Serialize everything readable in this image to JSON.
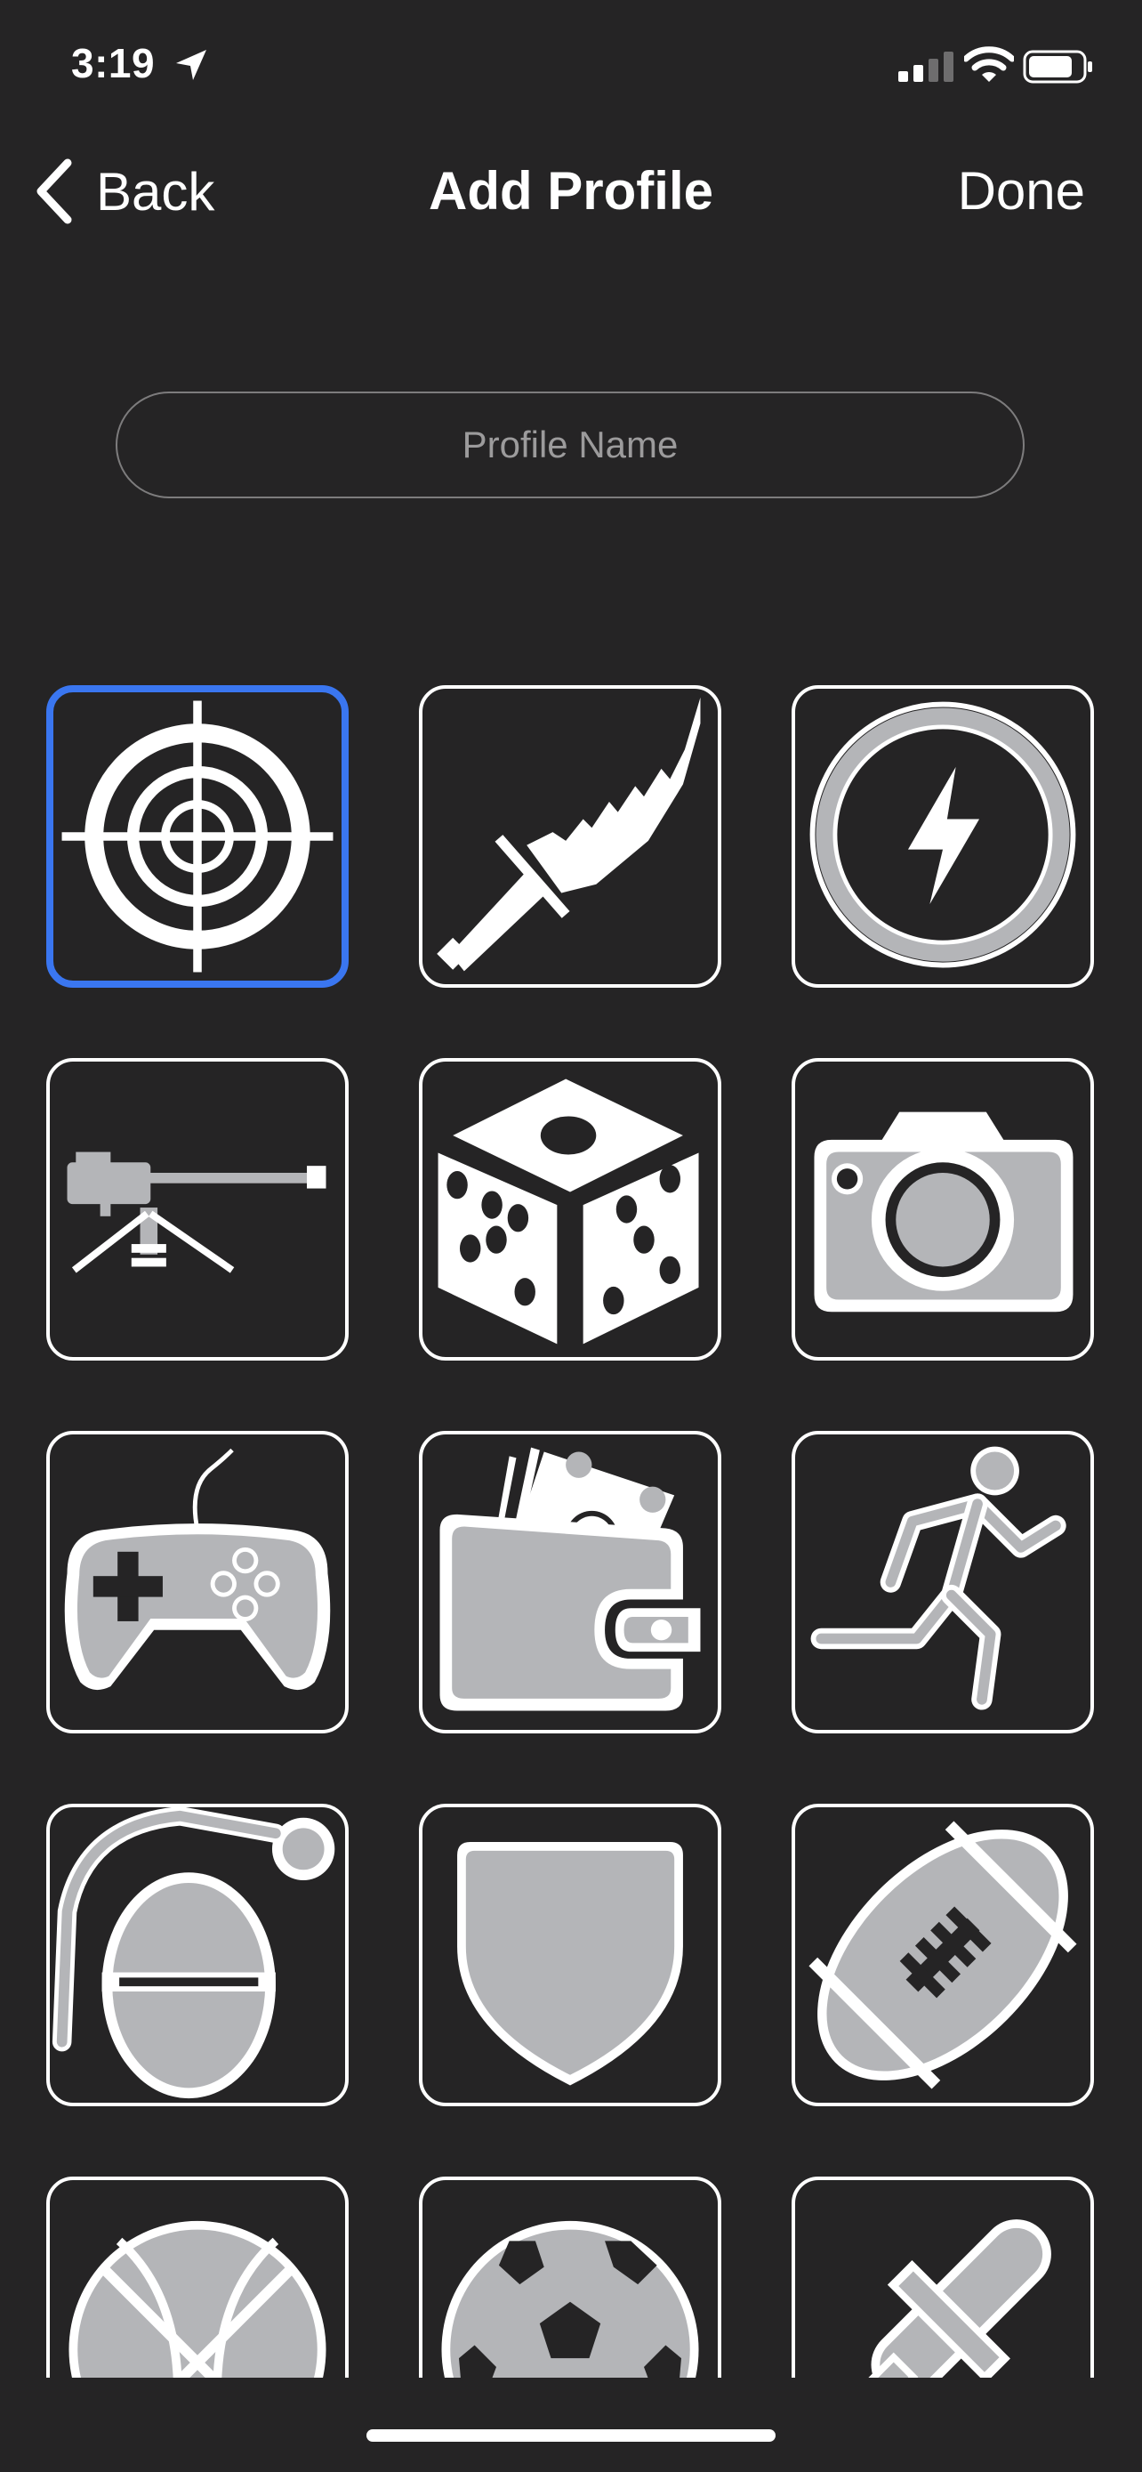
{
  "status_bar": {
    "time": "3:19",
    "icons": [
      "location-arrow-icon",
      "cellular-signal-icon",
      "wifi-icon",
      "battery-icon"
    ]
  },
  "nav": {
    "back_label": "Back",
    "title": "Add Profile",
    "done_label": "Done"
  },
  "profile_name": {
    "placeholder": "Profile Name",
    "value": ""
  },
  "icon_grid": {
    "selected": "crosshair-icon",
    "icons": [
      "crosshair-icon",
      "knife-icon",
      "lightning-icon",
      "machine-gun-icon",
      "dice-icon",
      "camera-icon",
      "gamepad-icon",
      "wallet-icon",
      "runner-icon",
      "grenade-icon",
      "shield-icon",
      "football-icon",
      "basketball-icon",
      "soccer-ball-icon",
      "syringe-icon"
    ]
  },
  "colors": {
    "background": "#252425",
    "selection": "#3a76f0",
    "icon_fill": "#b4b5b8",
    "tile_border": "#ffffff"
  }
}
